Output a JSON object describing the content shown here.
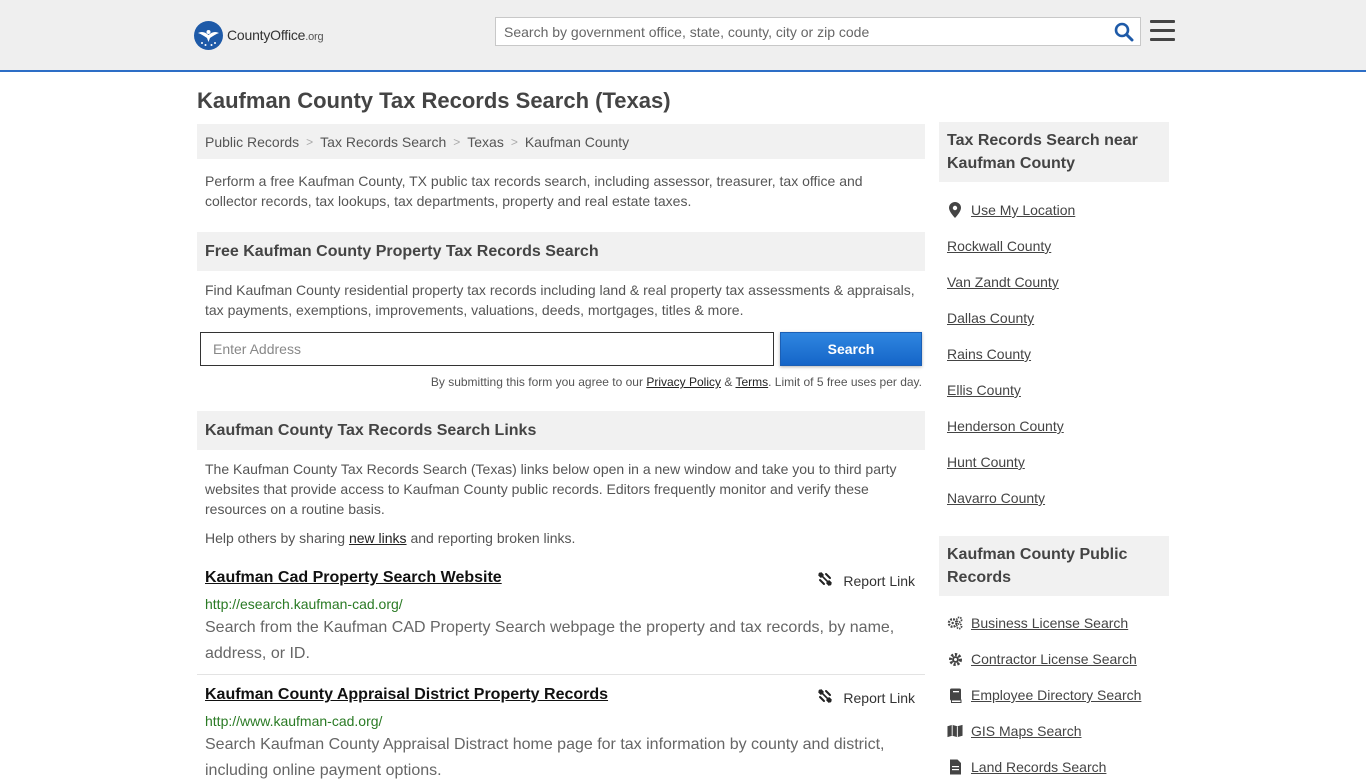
{
  "header": {
    "logo_text": "CountyOffice",
    "logo_tld": ".org",
    "search_placeholder": "Search by government office, state, county, city or zip code"
  },
  "page_title": "Kaufman County Tax Records Search (Texas)",
  "breadcrumb": [
    "Public Records",
    "Tax Records Search",
    "Texas",
    "Kaufman County"
  ],
  "intro": "Perform a free Kaufman County, TX public tax records search, including assessor, treasurer, tax office and collector records, tax lookups, tax departments, property and real estate taxes.",
  "property_search": {
    "heading": "Free Kaufman County Property Tax Records Search",
    "description": "Find Kaufman County residential property tax records including land & real property tax assessments & appraisals, tax payments, exemptions, improvements, valuations, deeds, mortgages, titles & more.",
    "address_placeholder": "Enter Address",
    "submit_label": "Search",
    "disclaimer_before": "By submitting this form you agree to our ",
    "privacy_label": "Privacy Policy",
    "amp": " & ",
    "terms_label": "Terms",
    "disclaimer_after": ". Limit of 5 free uses per day."
  },
  "links_section": {
    "heading": "Kaufman County Tax Records Search Links",
    "description": "The Kaufman County Tax Records Search (Texas) links below open in a new window and take you to third party websites that provide access to Kaufman County public records. Editors frequently monitor and verify these resources on a routine basis.",
    "share_before": "Help others by sharing ",
    "share_link": "new links",
    "share_after": " and reporting broken links.",
    "report_label": "Report Link",
    "items": [
      {
        "title": "Kaufman Cad Property Search Website",
        "url": "http://esearch.kaufman-cad.org/",
        "description": "Search from the Kaufman CAD Property Search webpage the property and tax records, by name, address, or ID."
      },
      {
        "title": "Kaufman County Appraisal District Property Records",
        "url": "http://www.kaufman-cad.org/",
        "description": "Search Kaufman County Appraisal Distract home page for tax information by county and district, including online payment options."
      }
    ]
  },
  "sidebar": {
    "nearby_heading": "Tax Records Search near Kaufman County",
    "use_location": "Use My Location",
    "nearby": [
      "Rockwall County",
      "Van Zandt County",
      "Dallas County",
      "Rains County",
      "Ellis County",
      "Henderson County",
      "Hunt County",
      "Navarro County"
    ],
    "public_heading": "Kaufman County Public Records",
    "public_records": [
      {
        "label": "Business License Search",
        "icon": "gears-icon"
      },
      {
        "label": "Contractor License Search",
        "icon": "gear-icon"
      },
      {
        "label": "Employee Directory Search",
        "icon": "book-icon"
      },
      {
        "label": "GIS Maps Search",
        "icon": "map-icon"
      },
      {
        "label": "Land Records Search",
        "icon": "document-icon"
      }
    ]
  },
  "colors": {
    "accent": "#2d6ec6",
    "button": "#1e6fd0",
    "url_green": "#2a7a24",
    "panel_bg": "#f1f1f1"
  }
}
